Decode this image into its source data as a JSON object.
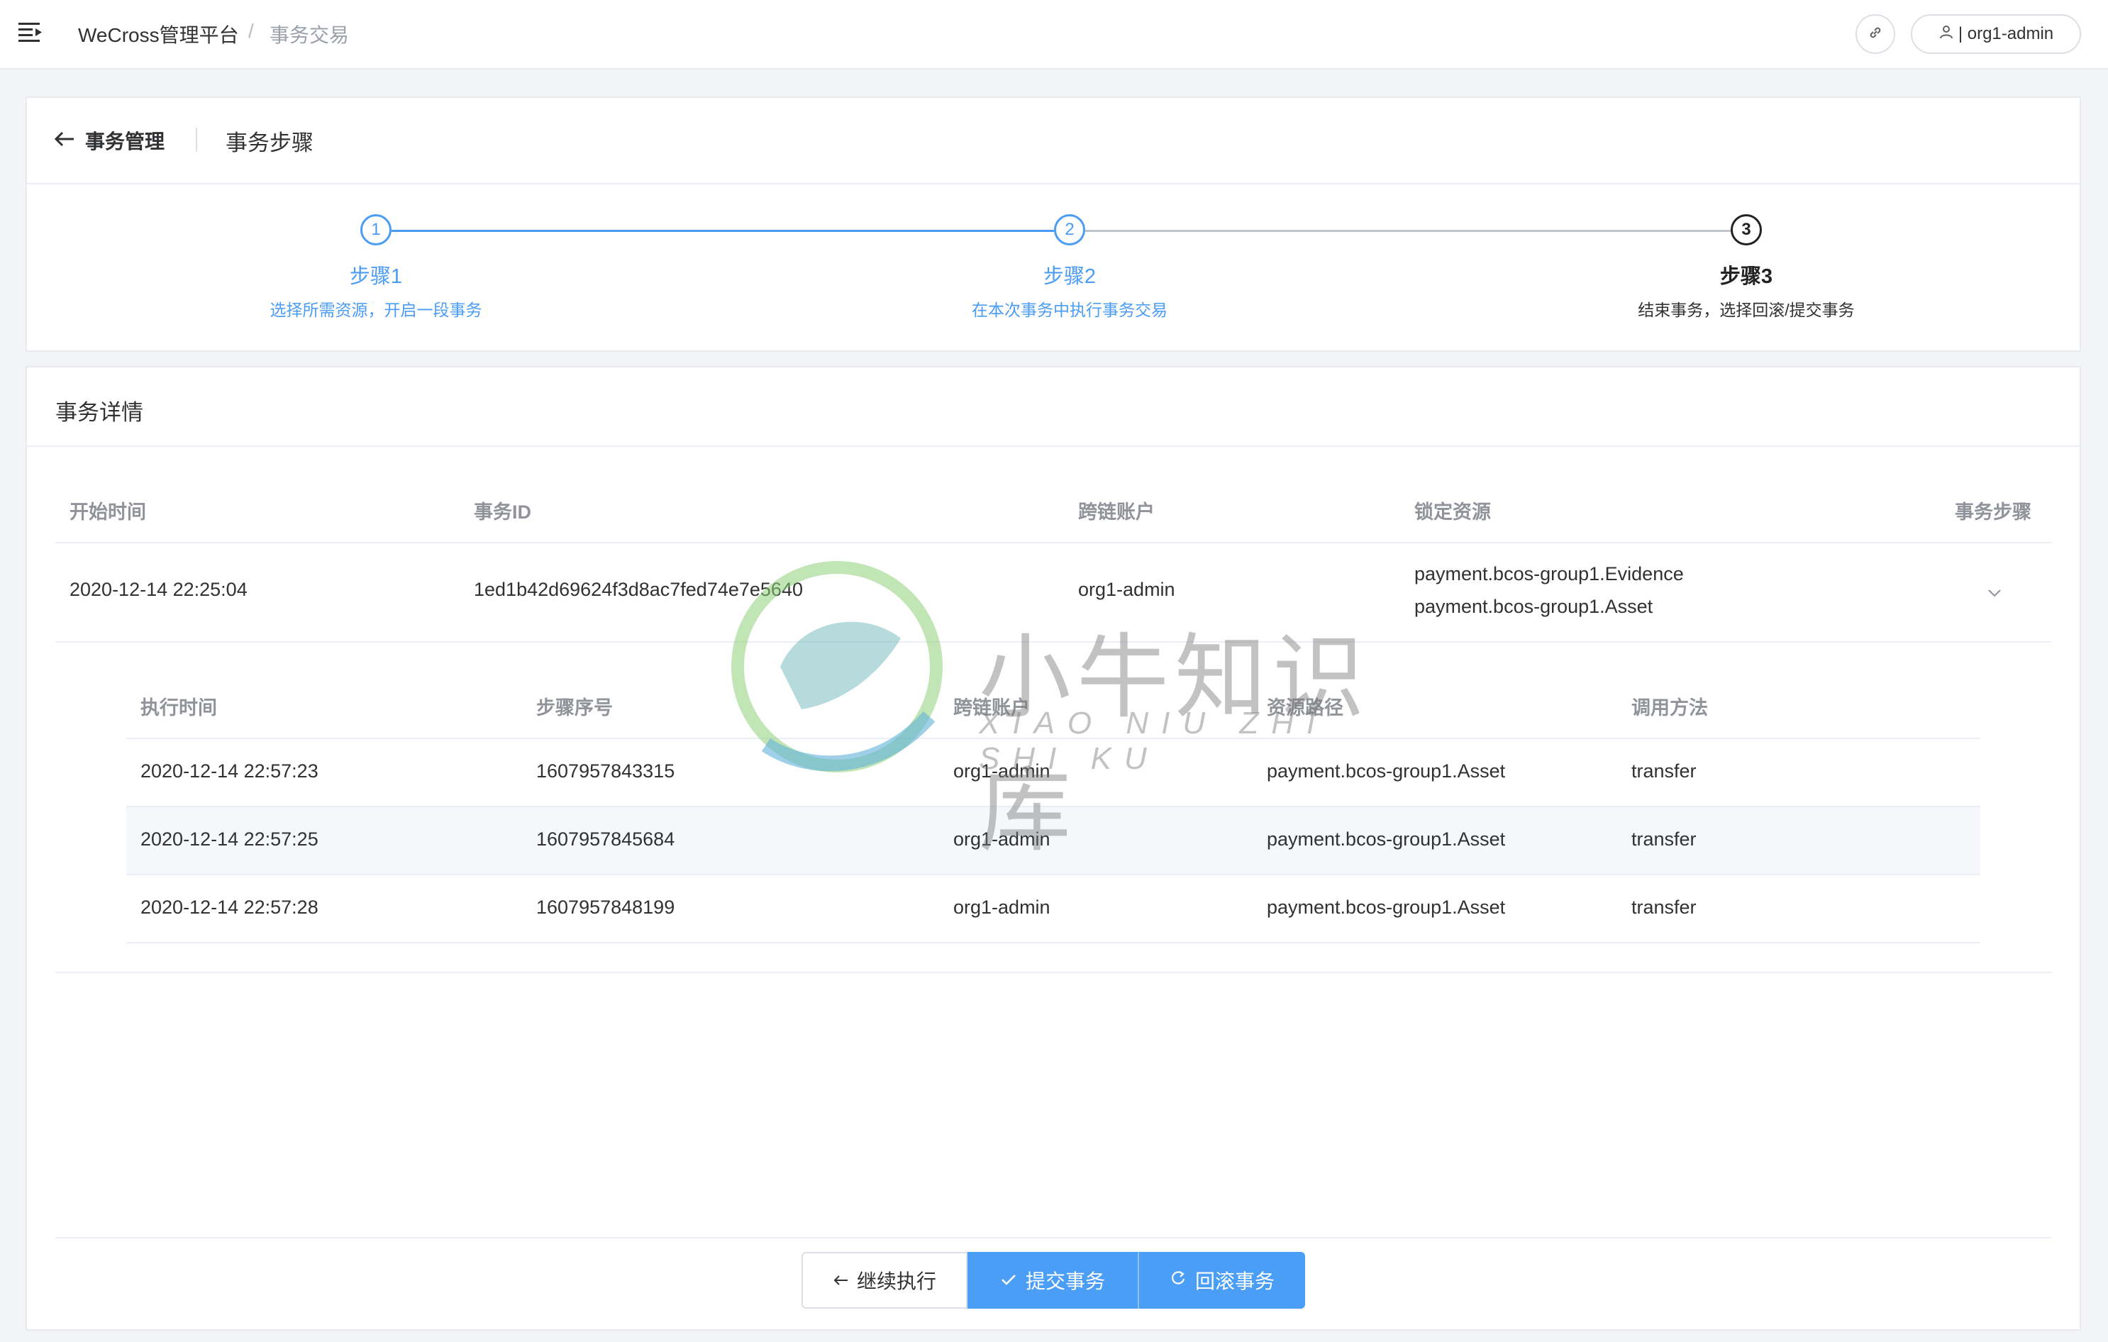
{
  "topbar": {
    "breadcrumb_root": "WeCross管理平台",
    "breadcrumb_sep": "/",
    "breadcrumb_current": "事务交易",
    "user_label": "| org1-admin"
  },
  "header_card": {
    "back_label": "事务管理",
    "title": "事务步骤"
  },
  "steps": [
    {
      "number": "1",
      "title": "步骤1",
      "desc": "选择所需资源，开启一段事务",
      "status": "done"
    },
    {
      "number": "2",
      "title": "步骤2",
      "desc": "在本次事务中执行事务交易",
      "status": "done"
    },
    {
      "number": "3",
      "title": "步骤3",
      "desc": "结束事务，选择回滚/提交事务",
      "status": "active"
    }
  ],
  "details": {
    "title": "事务详情",
    "columns": {
      "start_time": "开始时间",
      "tx_id": "事务ID",
      "account": "跨链账户",
      "locked": "锁定资源",
      "steps": "事务步骤"
    },
    "row": {
      "start_time": "2020-12-14 22:25:04",
      "tx_id": "1ed1b42d69624f3d8ac7fed74e7e5640",
      "account": "org1-admin",
      "locked_1": "payment.bcos-group1.Evidence",
      "locked_2": "payment.bcos-group1.Asset"
    },
    "sub_columns": {
      "exec_time": "执行时间",
      "seq": "步骤序号",
      "account": "跨链账户",
      "path": "资源路径",
      "method": "调用方法"
    },
    "sub_rows": [
      {
        "exec_time": "2020-12-14 22:57:23",
        "seq": "1607957843315",
        "account": "org1-admin",
        "path": "payment.bcos-group1.Asset",
        "method": "transfer"
      },
      {
        "exec_time": "2020-12-14 22:57:25",
        "seq": "1607957845684",
        "account": "org1-admin",
        "path": "payment.bcos-group1.Asset",
        "method": "transfer"
      },
      {
        "exec_time": "2020-12-14 22:57:28",
        "seq": "1607957848199",
        "account": "org1-admin",
        "path": "payment.bcos-group1.Asset",
        "method": "transfer"
      }
    ]
  },
  "buttons": {
    "continue": "继续执行",
    "commit": "提交事务",
    "rollback": "回滚事务"
  },
  "watermark": {
    "text_cn": "小牛知识库",
    "text_en": "XIAO NIU ZHI SHI KU"
  },
  "colors": {
    "primary": "#4b9ef6",
    "text": "#303133",
    "muted": "#909399"
  }
}
